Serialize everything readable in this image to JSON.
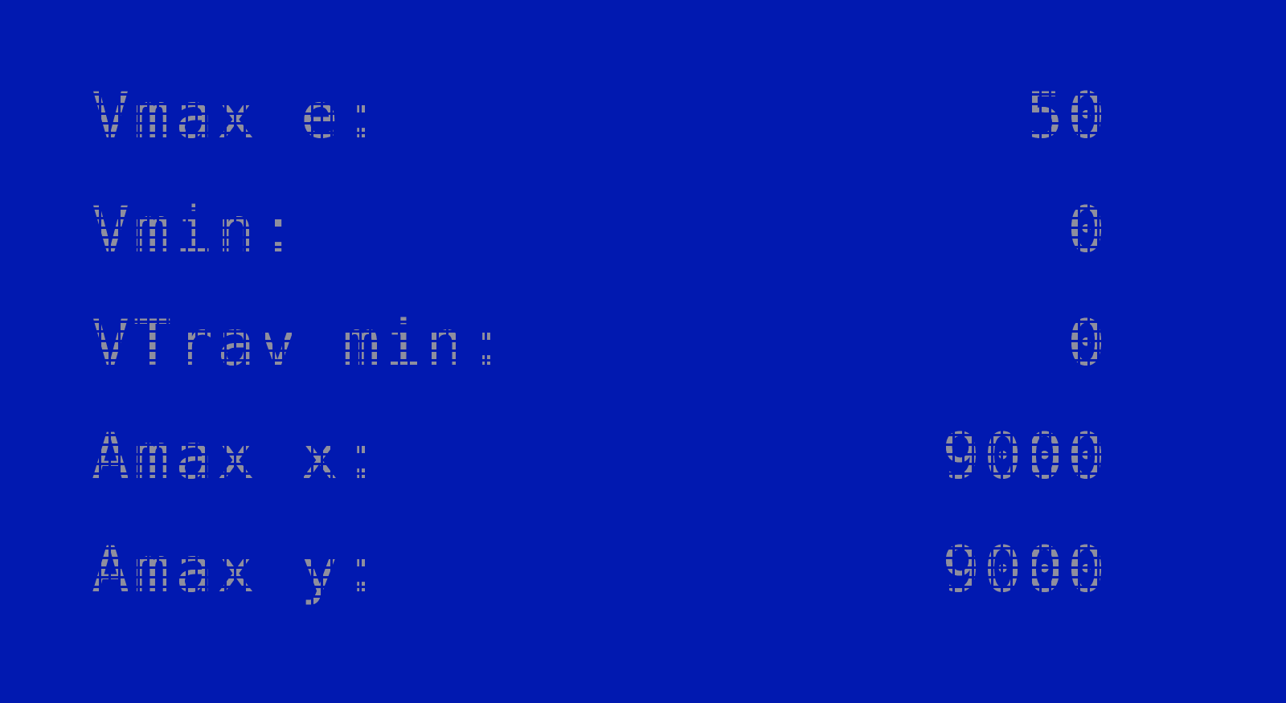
{
  "colors": {
    "background": "#0119b0",
    "text": "#8e8e9e"
  },
  "rows": [
    {
      "label": "Vmax e:",
      "value": "50"
    },
    {
      "label": "Vmin:",
      "value": "0"
    },
    {
      "label": "VTrav min:",
      "value": "0"
    },
    {
      "label": "Amax x:",
      "value": "9000"
    },
    {
      "label": "Amax y:",
      "value": "9000"
    }
  ]
}
